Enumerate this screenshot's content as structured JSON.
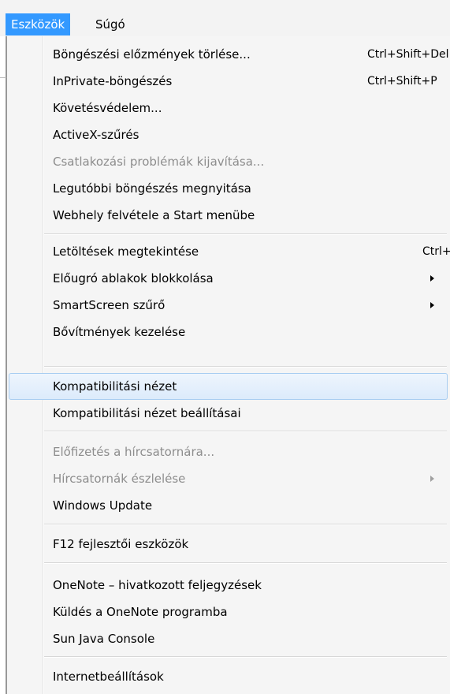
{
  "menubar": {
    "items": [
      {
        "label": "Eszközök",
        "active": true
      },
      {
        "label": "Súgó",
        "active": false
      }
    ]
  },
  "menu": {
    "items": [
      {
        "label": "Böngészési előzmények törlése...",
        "shortcut": "Ctrl+Shift+Del",
        "enabled": true
      },
      {
        "label": "InPrivate-böngészés",
        "shortcut": "Ctrl+Shift+P",
        "enabled": true
      },
      {
        "label": "Követésvédelem...",
        "enabled": true
      },
      {
        "label": "ActiveX-szűrés",
        "enabled": true
      },
      {
        "label": "Csatlakozási problémák kijavítása...",
        "enabled": false
      },
      {
        "label": "Legutóbbi böngészés megnyitása",
        "enabled": true
      },
      {
        "label": "Webhely felvétele a Start menübe",
        "enabled": true
      },
      {
        "label": "Letöltések megtekintése",
        "shortcut": "Ctrl+J",
        "enabled": true
      },
      {
        "label": "Előugró ablakok blokkolása",
        "submenu": true,
        "enabled": true
      },
      {
        "label": "SmartScreen szűrő",
        "submenu": true,
        "enabled": true
      },
      {
        "label": "Bővítmények kezelése",
        "enabled": true
      },
      {
        "label": "Kompatibilitási nézet",
        "enabled": true,
        "highlighted": true
      },
      {
        "label": "Kompatibilitási nézet beállításai",
        "enabled": true
      },
      {
        "label": "Előfizetés a hírcsatornára...",
        "enabled": false
      },
      {
        "label": "Hírcsatornák észlelése",
        "submenu": true,
        "enabled": false
      },
      {
        "label": "Windows Update",
        "enabled": true
      },
      {
        "label": "F12 fejlesztői eszközök",
        "enabled": true
      },
      {
        "label": "OneNote – hivatkozott feljegyzések",
        "enabled": true
      },
      {
        "label": "Küldés a OneNote programba",
        "enabled": true
      },
      {
        "label": "Sun Java Console",
        "enabled": true
      },
      {
        "label": "Internetbeállítások",
        "enabled": true
      }
    ]
  },
  "colors": {
    "menubar_active_bg": "#3399ff",
    "highlight_border": "#a8cdf1",
    "disabled_text": "#8d8d8d"
  }
}
